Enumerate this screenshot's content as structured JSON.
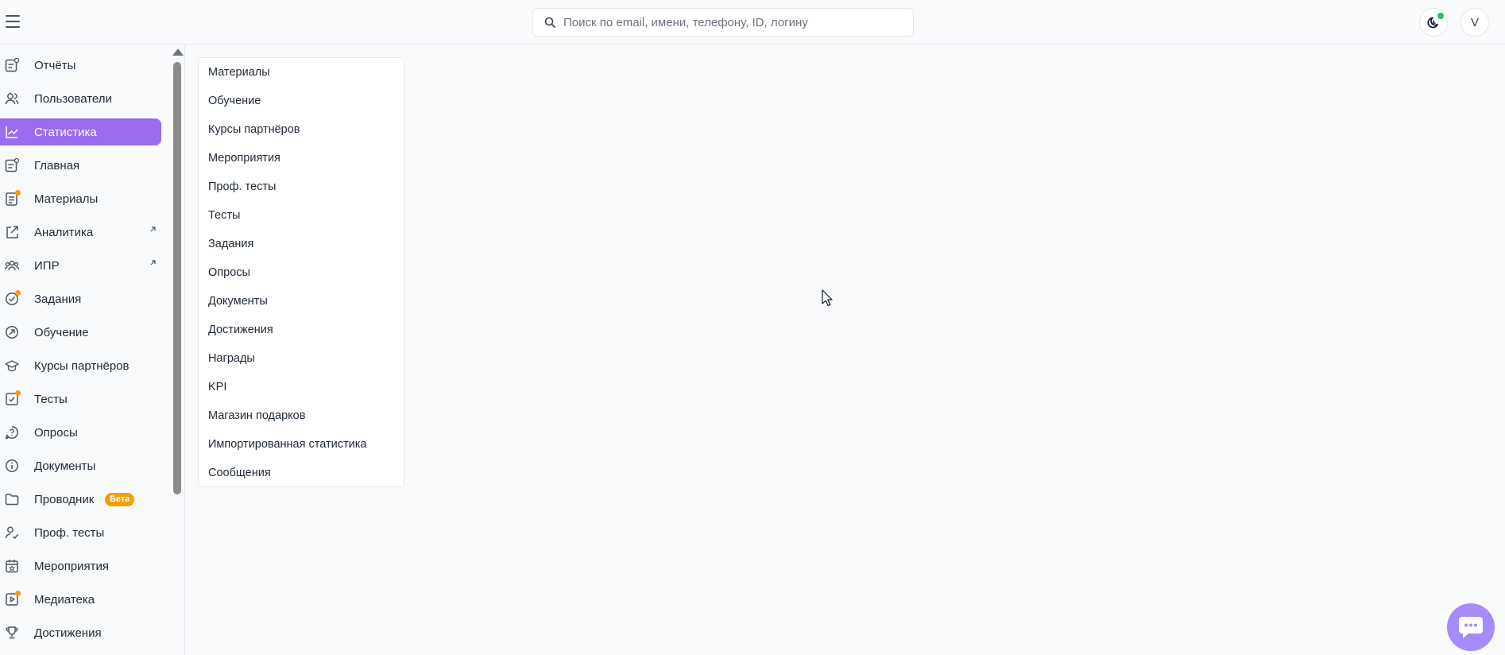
{
  "header": {
    "search_placeholder": "Поиск по email, имени, телефону, ID, логину",
    "avatar_initial": "V"
  },
  "sidebar": {
    "items": [
      {
        "label": "Отчёты",
        "icon": "report-icon"
      },
      {
        "label": "Пользователи",
        "icon": "users-icon"
      },
      {
        "label": "Статистика",
        "icon": "chart-line-icon",
        "active": true
      },
      {
        "label": "Главная",
        "icon": "home-feed-icon"
      },
      {
        "label": "Материалы",
        "icon": "materials-icon",
        "dot": true
      },
      {
        "label": "Аналитика",
        "icon": "external-analytics-icon",
        "external": true
      },
      {
        "label": "ИПР",
        "icon": "team-icon",
        "external": true
      },
      {
        "label": "Задания",
        "icon": "task-check-icon",
        "dot": true
      },
      {
        "label": "Обучение",
        "icon": "learning-icon"
      },
      {
        "label": "Курсы партнёров",
        "icon": "graduation-cap-icon"
      },
      {
        "label": "Тесты",
        "icon": "test-icon",
        "dot": true
      },
      {
        "label": "Опросы",
        "icon": "survey-icon"
      },
      {
        "label": "Документы",
        "icon": "info-document-icon"
      },
      {
        "label": "Проводник",
        "icon": "folder-icon",
        "badge": "Бета"
      },
      {
        "label": "Проф. тесты",
        "icon": "user-check-icon"
      },
      {
        "label": "Мероприятия",
        "icon": "calendar-star-icon"
      },
      {
        "label": "Медиатека",
        "icon": "media-icon",
        "dot": true
      },
      {
        "label": "Достижения",
        "icon": "trophy-icon"
      }
    ]
  },
  "submenu": {
    "items": [
      "Материалы",
      "Обучение",
      "Курсы партнёров",
      "Мероприятия",
      "Проф. тесты",
      "Тесты",
      "Задания",
      "Опросы",
      "Документы",
      "Достижения",
      "Награды",
      "KPI",
      "Магазин подарков",
      "Импортированная статистика",
      "Сообщения"
    ]
  },
  "colors": {
    "accent": "#9b6bf0",
    "badge": "#f59e0b",
    "online": "#22c55e",
    "chat": "#a78bfa"
  }
}
